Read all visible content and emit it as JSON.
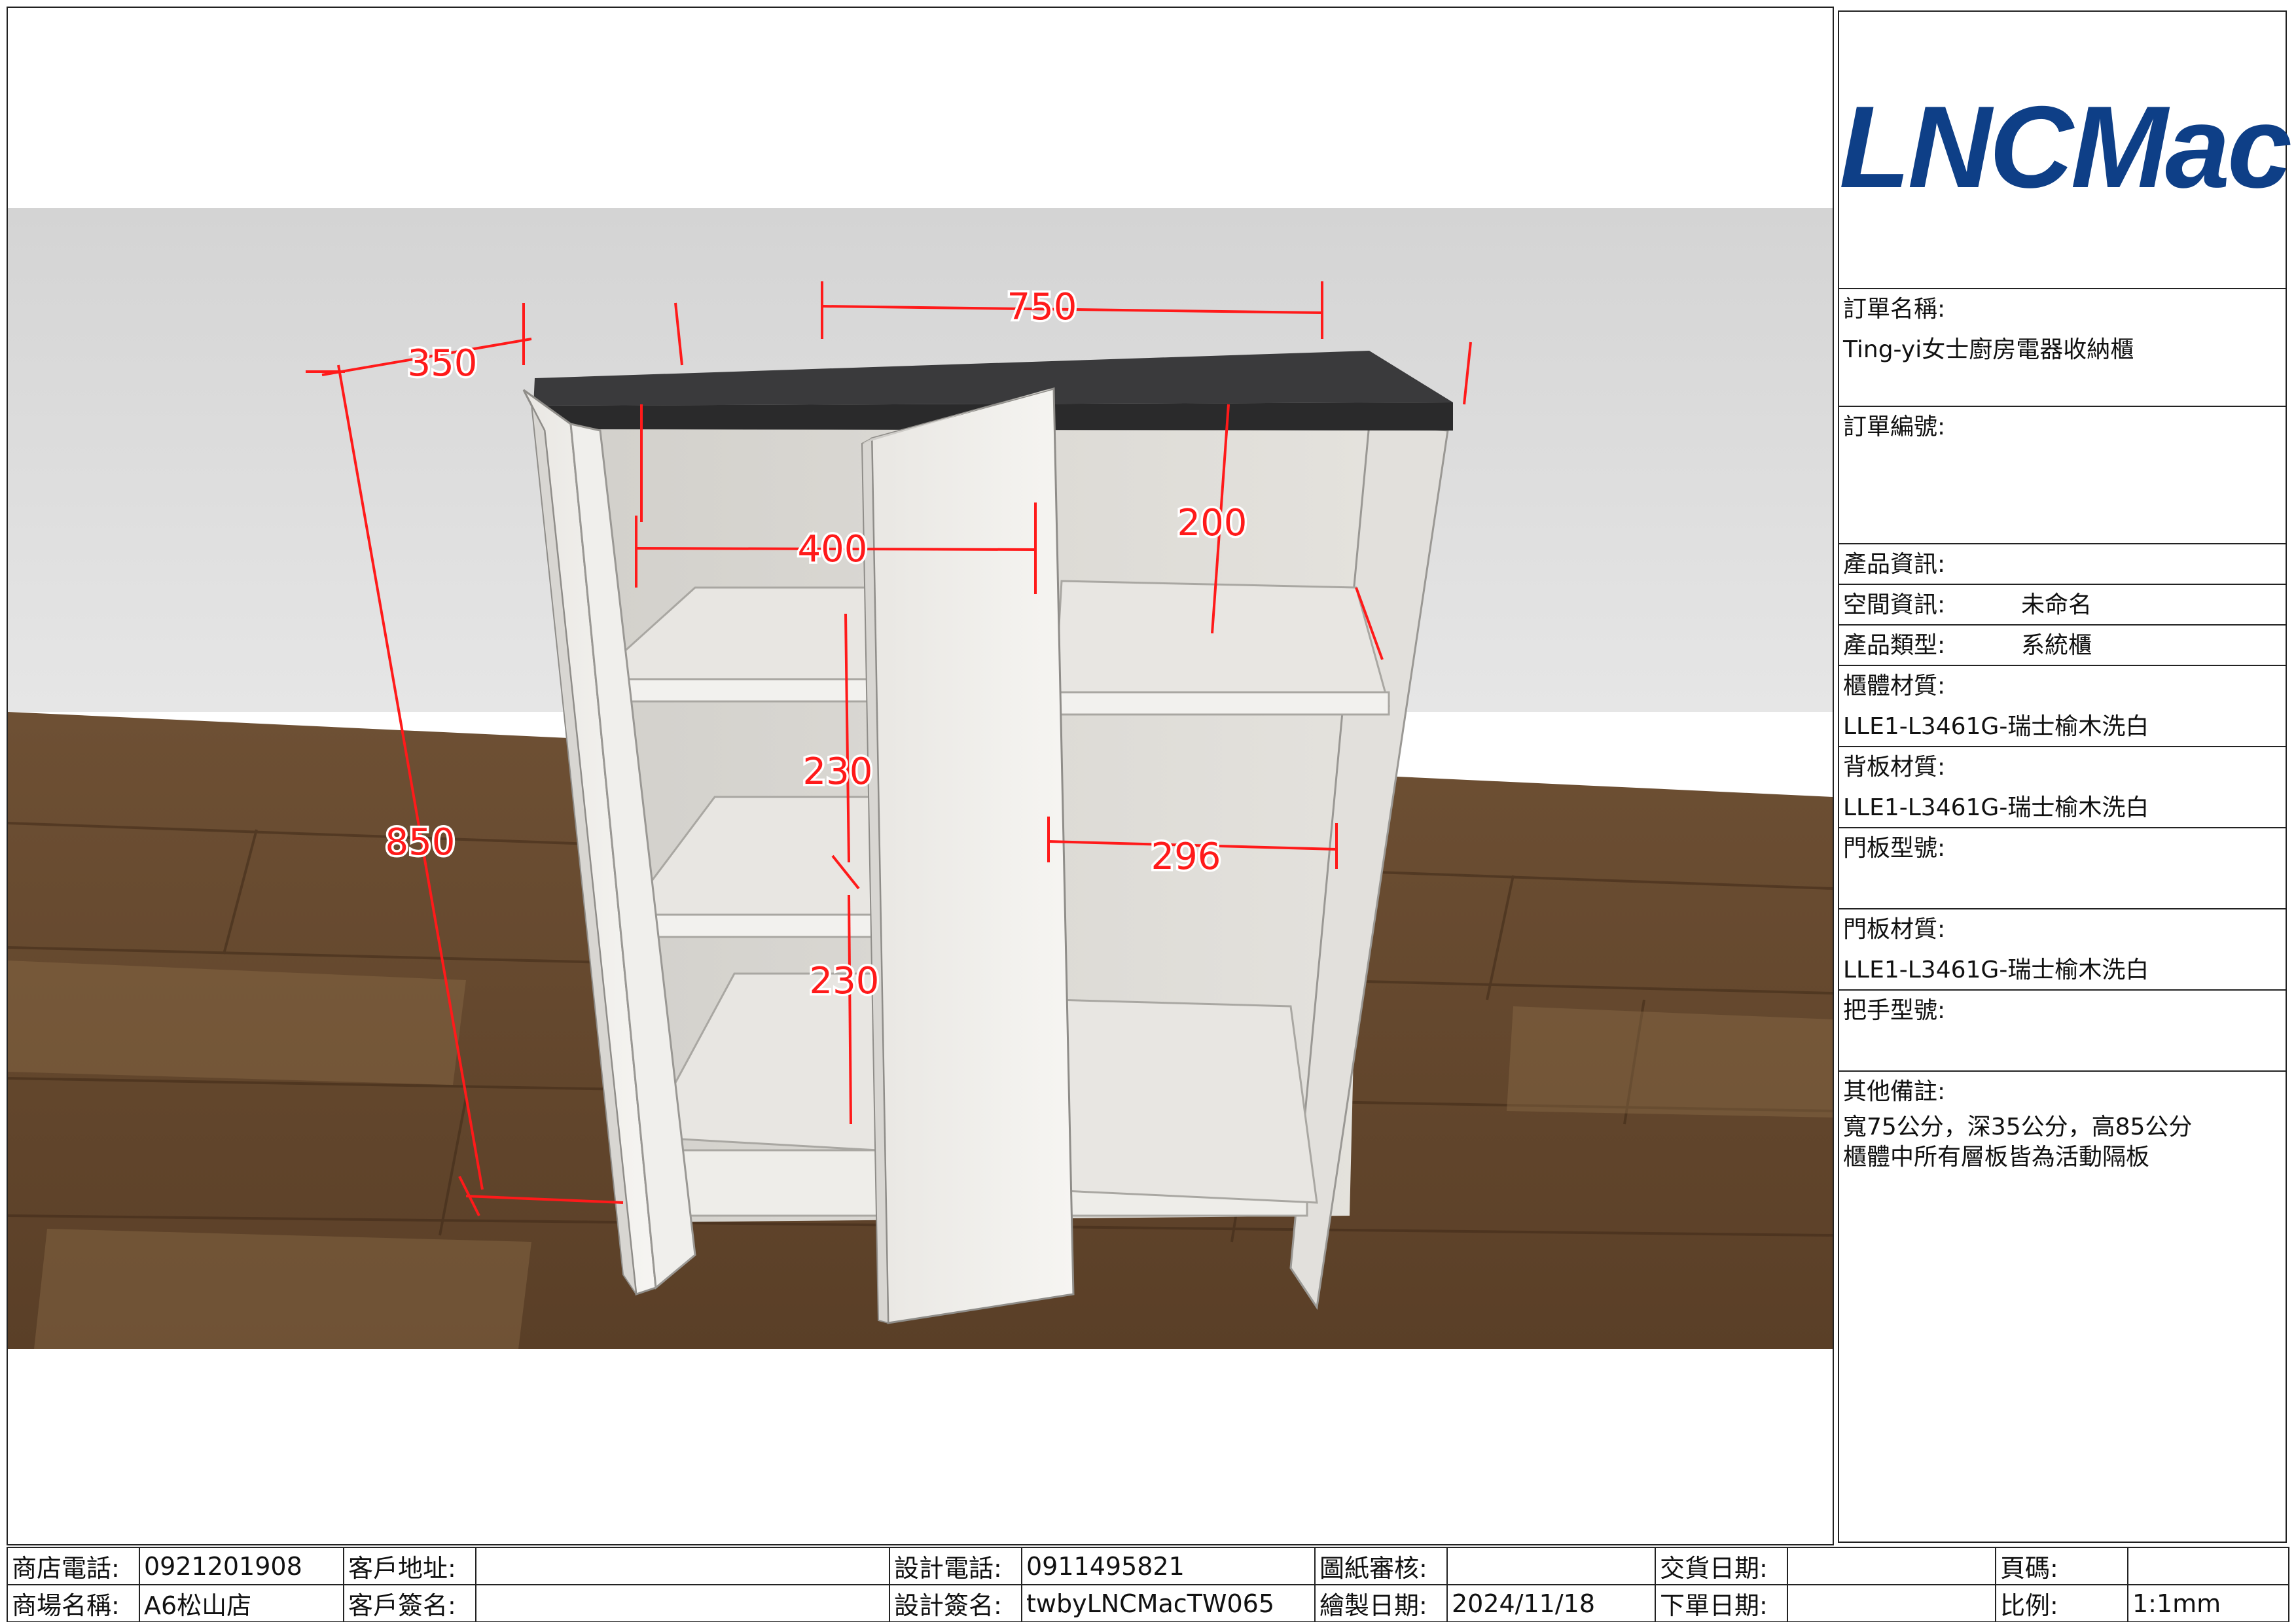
{
  "logo": {
    "text": "LNCMac",
    "color": "#0e3f87"
  },
  "drawing": {
    "dim_color": "#ff1a1a",
    "dimensions": {
      "width": "750",
      "depth": "350",
      "height": "850",
      "left_inner_width": "400",
      "right_inner_depth": "200",
      "shelf_gap_upper": "230",
      "shelf_gap_lower": "230",
      "right_inner_width": "296"
    }
  },
  "info_panel": {
    "order_name": {
      "label": "訂單名稱:",
      "value": "Ting-yi女士廚房電器收納櫃"
    },
    "order_number": {
      "label": "訂單編號:",
      "value": ""
    },
    "product_info": {
      "label": "產品資訊:"
    },
    "space_info": {
      "label": "空間資訊:",
      "value": "未命名"
    },
    "product_type": {
      "label": "產品類型:",
      "value": "系統櫃"
    },
    "cabinet_material": {
      "label": "櫃體材質:",
      "value": "LLE1-L3461G-瑞士榆木洗白"
    },
    "back_material": {
      "label": "背板材質:",
      "value": "LLE1-L3461G-瑞士榆木洗白"
    },
    "door_model": {
      "label": "門板型號:",
      "value": ""
    },
    "door_material": {
      "label": "門板材質:",
      "value": "LLE1-L3461G-瑞士榆木洗白"
    },
    "handle_model": {
      "label": "把手型號:",
      "value": ""
    },
    "remarks": {
      "label": "其他備註:",
      "line1": "寬75公分，深35公分，高85公分",
      "line2": "櫃體中所有層板皆為活動隔板"
    }
  },
  "footer": {
    "row1": {
      "store_phone_label": "商店電話:",
      "store_phone": "0921201908",
      "customer_address_label": "客戶地址:",
      "customer_address": "",
      "design_phone_label": "設計電話:",
      "design_phone": "0911495821",
      "review_label": "圖紙審核:",
      "review": "",
      "delivery_date_label": "交貨日期:",
      "delivery_date": "",
      "page_label": "頁碼:",
      "page": ""
    },
    "row2": {
      "mall_name_label": "商場名稱:",
      "mall_name": "A6松山店",
      "customer_sign_label": "客戶簽名:",
      "customer_sign": "",
      "design_sign_label": "設計簽名:",
      "design_sign": "twbyLNCMacTW065",
      "drawing_date_label": "繪製日期:",
      "drawing_date": "2024/11/18",
      "order_date_label": "下單日期:",
      "order_date": "",
      "scale_label": "比例:",
      "scale": "1:1mm"
    }
  }
}
